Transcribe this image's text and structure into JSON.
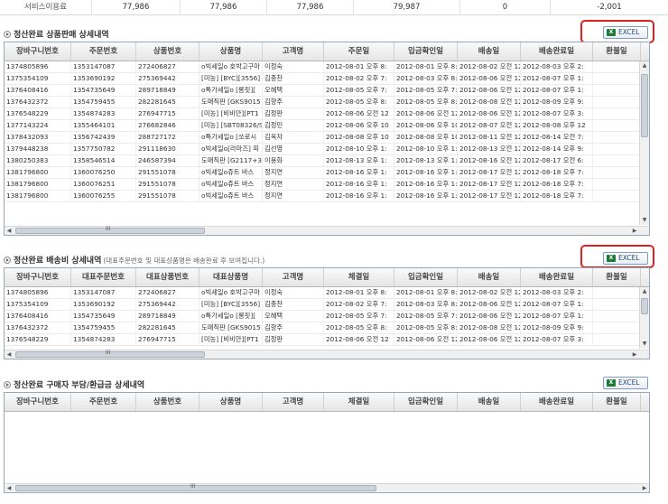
{
  "summary": {
    "label": "서비스이용료",
    "values": [
      "77,986",
      "77,986",
      "77,986",
      "79,987",
      "0",
      "-2,001"
    ]
  },
  "section1": {
    "title": "정산완료 상품판매 상세내역",
    "excel_label": "EXCEL",
    "columns": [
      "장바구니번호",
      "주문번호",
      "상품번호",
      "상품명",
      "고객명",
      "주문일",
      "입금확인일",
      "배송일",
      "배송완료일",
      "환불일"
    ],
    "rows": [
      [
        "1374805896",
        "1353147087",
        "272406827",
        "o빅세일o 호박고구마",
        "이정숙",
        "2012-08-01 오후 8:",
        "2012-08-01 오후 8:",
        "2012-08-02 오전 12",
        "2012-08-03 오후 2:",
        ""
      ],
      [
        "1375354109",
        "1353690192",
        "275369442",
        "[미농] [BYC][3556] 스",
        "김종찬",
        "2012-08-02 오후 7:",
        "2012-08-03 오후 8:",
        "2012-08-06 오전 12",
        "2012-08-07 오후 1:",
        ""
      ],
      [
        "1376408416",
        "1354735649",
        "289718849",
        "o특가세일o [롱핏][",
        "오혜택",
        "2012-08-05 오후 7:",
        "2012-08-05 오후 7:",
        "2012-08-06 오전 12",
        "2012-08-07 오후 1:",
        ""
      ],
      [
        "1376432372",
        "1354759455",
        "282281645",
        "도매직판 [GKS9015",
        "김향주",
        "2012-08-05 오후 8:",
        "2012-08-05 오후 8:",
        "2012-08-08 오전 12",
        "2012-08-09 오후 9:",
        ""
      ],
      [
        "1376548229",
        "1354874283",
        "276947715",
        "[미농] [비비안][PT1",
        "김정판",
        "2012-08-06 오전 12",
        "2012-08-06 오전 12",
        "2012-08-06 오전 12",
        "2012-08-07 오후 3:",
        ""
      ],
      [
        "1377143224",
        "1355464101",
        "276682846",
        "[미농] [SBT08326/S",
        "김정민",
        "2012-08-06 오후 10",
        "2012-08-06 오후 10",
        "2012-08-07 오전 12",
        "2012-08-08 오후 12",
        ""
      ],
      [
        "1378432093",
        "1356742439",
        "288727172",
        "o특가세일o [쏘로시",
        "김옥자",
        "2012-08-08 오후 10",
        "2012-08-08 오후 10",
        "2012-08-11 오전 12",
        "2012-08-14 오전 7:",
        ""
      ],
      [
        "1379448238",
        "1357750782",
        "291118630",
        "o빅세일o[라마즈] 피",
        "김선영",
        "2012-08-10 오후 1:",
        "2012-08-10 오후 1:",
        "2012-08-13 오전 12",
        "2012-08-14 오후 9:",
        ""
      ],
      [
        "1380250383",
        "1358546514",
        "246587394",
        "도매직판 [G2117+3",
        "이용화",
        "2012-08-13 오후 1:",
        "2012-08-13 오후 1:",
        "2012-08-16 오전 12",
        "2012-08-17 오전 6:",
        ""
      ],
      [
        "1381796800",
        "1360076250",
        "291551078",
        "o빅세일o쥬트 바스",
        "정지연",
        "2012-08-16 오후 1:",
        "2012-08-16 오후 1:",
        "2012-08-17 오전 12",
        "2012-08-18 오후 7:",
        ""
      ],
      [
        "1381796800",
        "1360076251",
        "291551078",
        "o빅세일o쥬트 바스",
        "정지연",
        "2012-08-16 오후 1:",
        "2012-08-16 오후 1:",
        "2012-08-17 오전 12",
        "2012-08-18 오후 7:",
        ""
      ],
      [
        "1381796800",
        "1360076255",
        "291551078",
        "o빅세일o쥬트 바스",
        "정지연",
        "2012-08-16 오후 1:",
        "2012-08-16 오후 1:",
        "2012-08-17 오전 12",
        "2012-08-18 오후 7:",
        ""
      ]
    ]
  },
  "section2": {
    "title": "정산완료 배송비 상세내역",
    "note": "(대표주문번호 및 대표상품명은 배송완료 후 보여집니다.)",
    "excel_label": "EXCEL",
    "columns": [
      "장바구니번호",
      "대표주문번호",
      "대표상품번호",
      "대표상품명",
      "고객명",
      "체결일",
      "입금확인일",
      "배송일",
      "배송완료일",
      "환불일"
    ],
    "rows": [
      [
        "1374805896",
        "1353147087",
        "272406827",
        "o빅세일o 호박고구마",
        "이정숙",
        "2012-08-01 오후 8:",
        "2012-08-01 오후 8:",
        "2012-08-02 오전 12",
        "2012-08-03 오후 2:",
        ""
      ],
      [
        "1375354109",
        "1353690192",
        "275369442",
        "[미농] [BYC][3556] 스",
        "김종찬",
        "2012-08-02 오후 7:",
        "2012-08-03 오후 8:",
        "2012-08-06 오전 12",
        "2012-08-07 오후 1:",
        ""
      ],
      [
        "1376408416",
        "1354735649",
        "289718849",
        "o특가세일o [롱핏][",
        "오혜택",
        "2012-08-05 오후 7:",
        "2012-08-05 오후 7:",
        "2012-08-06 오전 12",
        "2012-08-07 오후 1:",
        ""
      ],
      [
        "1376432372",
        "1354759455",
        "282281645",
        "도매직판 [GKS9015",
        "김향주",
        "2012-08-05 오후 8:",
        "2012-08-05 오후 8:",
        "2012-08-08 오전 12",
        "2012-08-09 오후 9:",
        ""
      ],
      [
        "1376548229",
        "1354874283",
        "276947715",
        "[미농] [비비안][PT1",
        "김정판",
        "2012-08-06 오전 12",
        "2012-08-06 오전 12",
        "2012-08-06 오전 12",
        "2012-08-07 오후 3:",
        ""
      ]
    ]
  },
  "section3": {
    "title": "정산완료 구매자 부담/환급금 상세내역",
    "excel_label": "EXCEL",
    "columns": [
      "장바구니번호",
      "주문번호",
      "상품번호",
      "상품명",
      "고객명",
      "체결일",
      "입금확인일",
      "배송일",
      "배송완료일",
      "환불일"
    ],
    "rows": []
  },
  "icons": {
    "scroll_up": "▲",
    "scroll_down": "▼",
    "scroll_left": "◀",
    "scroll_right": "▶",
    "grip": "III"
  },
  "colors": {
    "highlight_box": "#e02020",
    "excel_green": "#1f7a3a"
  }
}
